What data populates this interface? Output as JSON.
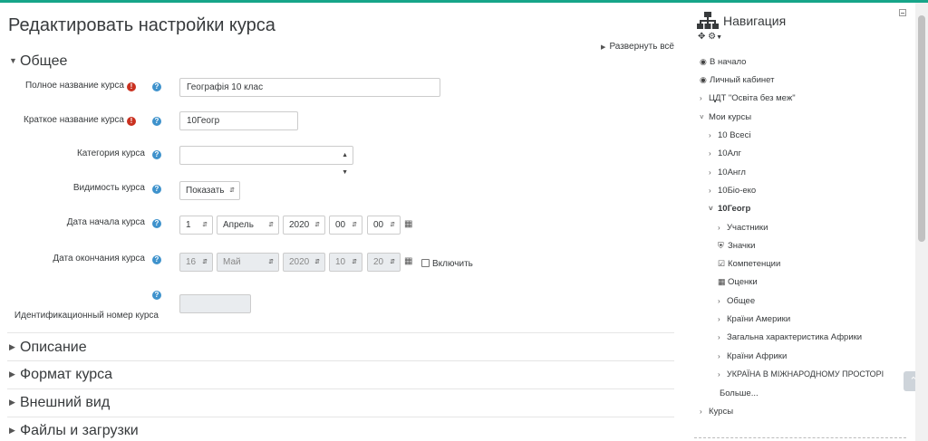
{
  "page": {
    "title": "Редактировать настройки курса",
    "expand_all": "Развернуть всё"
  },
  "sections": {
    "general": "Общее",
    "description": "Описание",
    "format": "Формат курса",
    "appearance": "Внешний вид",
    "files": "Файлы и загрузки"
  },
  "form": {
    "fullname_label": "Полное название курса",
    "fullname_value": "Географія 10 клас",
    "shortname_label": "Краткое название курса",
    "shortname_value": "10Геогр",
    "category_label": "Категория курса",
    "category_value": "",
    "visibility_label": "Видимость курса",
    "visibility_value": "Показать",
    "startdate_label": "Дата начала курса",
    "startdate": {
      "day": "1",
      "month": "Апрель",
      "year": "2020",
      "hour": "00",
      "minute": "00"
    },
    "enddate_label": "Дата окончания курса",
    "enddate": {
      "day": "16",
      "month": "Май",
      "year": "2020",
      "hour": "10",
      "minute": "20"
    },
    "enddate_enable": "Включить",
    "idnumber_label": "Идентификационный номер курса",
    "idnumber_value": ""
  },
  "nav": {
    "title": "Навигация",
    "items": {
      "home": "В начало",
      "dashboard": "Личный кабинет",
      "site": "ЦДТ \"Освіта без меж\"",
      "mycourses": "Мои курсы",
      "c1": "10 Всесі",
      "c2": "10Алг",
      "c3": "10Англ",
      "c4": "10Біо-еко",
      "c5": "10Геогр",
      "participants": "Участники",
      "badges": "Значки",
      "competencies": "Компетенции",
      "grades": "Оценки",
      "general": "Общее",
      "s1": "Країни Америки",
      "s2": "Загальна характеристика Африки",
      "s3": "Країни Африки",
      "s4": "УКРАЇНА В МІЖНАРОДНОМУ ПРОСТОРІ",
      "more": "Больше...",
      "courses": "Курсы"
    }
  }
}
